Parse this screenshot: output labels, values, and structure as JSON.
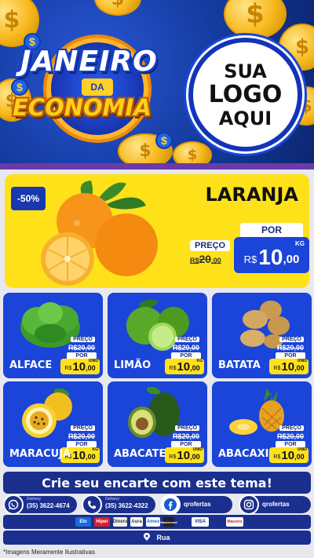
{
  "header": {
    "title_line1": "JANEIRO",
    "title_da": "DA",
    "title_line2": "ECONOMIA",
    "logo_placeholder": [
      "SUA",
      "LOGO",
      "AQUI"
    ]
  },
  "featured": {
    "discount": "-50%",
    "name": "LARANJA",
    "preco_label": "PREÇO",
    "old_currency": "R$",
    "old_int": "20",
    "old_dec": ",00",
    "por_label": "POR",
    "currency": "R$",
    "price_int": "10",
    "price_dec": ",00",
    "unit": "KG"
  },
  "products": [
    {
      "name": "ALFACE",
      "preco_label": "PREÇO",
      "old": "R$20,00",
      "por_label": "POR",
      "currency": "R$",
      "price_int": "10",
      "price_dec": ",00",
      "unit": "UNID"
    },
    {
      "name": "LIMÃO",
      "preco_label": "PREÇO",
      "old": "R$20,00",
      "por_label": "POR",
      "currency": "R$",
      "price_int": "10",
      "price_dec": ",00",
      "unit": "KG"
    },
    {
      "name": "BATATA",
      "preco_label": "PREÇO",
      "old": "R$20,00",
      "por_label": "POR",
      "currency": "R$",
      "price_int": "10",
      "price_dec": ",00",
      "unit": "UNID"
    },
    {
      "name": "MARACUJÁ",
      "preco_label": "PREÇO",
      "old": "R$20,00",
      "por_label": "POR",
      "currency": "R$",
      "price_int": "10",
      "price_dec": ",00",
      "unit": "KG"
    },
    {
      "name": "ABACATE",
      "preco_label": "PREÇO",
      "old": "R$20,00",
      "por_label": "POR",
      "currency": "R$",
      "price_int": "10",
      "price_dec": ",00",
      "unit": "UNID"
    },
    {
      "name": "ABACAXI",
      "preco_label": "PREÇO",
      "old": "R$20,00",
      "por_label": "POR",
      "currency": "R$",
      "price_int": "10",
      "price_dec": ",00",
      "unit": "UNID"
    }
  ],
  "banner": "Crie seu encarte com este tema!",
  "contacts": [
    {
      "icon": "whatsapp-icon",
      "label": "Delivery",
      "value": "(35) 3622-4674"
    },
    {
      "icon": "phone-icon",
      "label": "Delivery",
      "value": "(35) 3622-4322"
    },
    {
      "icon": "facebook-icon",
      "label": "",
      "value": "qrofertas"
    },
    {
      "icon": "instagram-icon",
      "label": "",
      "value": "qrofertas"
    }
  ],
  "payments": [
    "Elo",
    "Hiper",
    "Diners",
    "Aura",
    "Amex",
    "Mastercard",
    "VISA",
    "Maestro"
  ],
  "address": "Rua",
  "disclaimer": "*Imagens Meramente Ilustrativas",
  "colors": {
    "blue": "#1a45d8",
    "navy": "#1a2f8e",
    "yellow": "#ffe11a",
    "purple": "#6c3aa8"
  }
}
